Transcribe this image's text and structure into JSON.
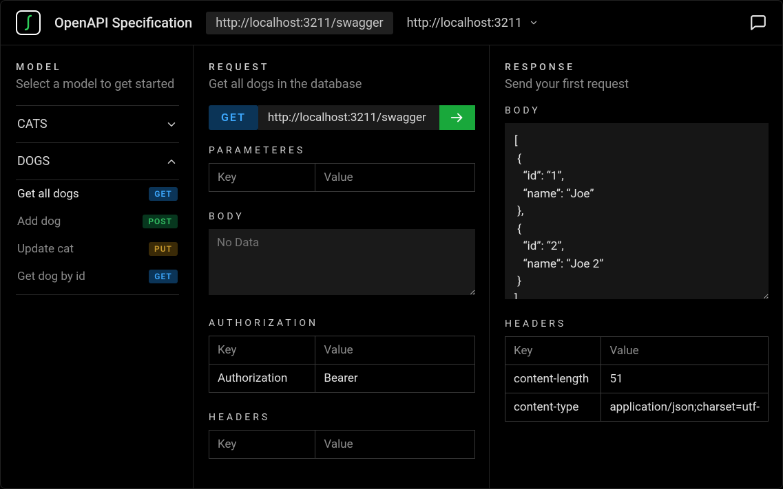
{
  "header": {
    "app_title": "OpenAPI Specification",
    "spec_url": "http://localhost:3211/swagger",
    "base_url": "http://localhost:3211"
  },
  "sidebar": {
    "title": "MODEL",
    "subtitle": "Select a model to get started",
    "groups": [
      {
        "name": "CATS",
        "expanded": false,
        "endpoints": []
      },
      {
        "name": "DOGS",
        "expanded": true,
        "endpoints": [
          {
            "label": "Get all dogs",
            "method": "GET",
            "active": true
          },
          {
            "label": "Add dog",
            "method": "POST",
            "active": false
          },
          {
            "label": "Update cat",
            "method": "PUT",
            "active": false
          },
          {
            "label": "Get dog by id",
            "method": "GET",
            "active": false
          }
        ]
      }
    ]
  },
  "request": {
    "title": "REQUEST",
    "subtitle": "Get all dogs in the database",
    "method": "GET",
    "url": "http://localhost:3211/swagger",
    "parameters": {
      "heading": "PARAMETERES",
      "key_header": "Key",
      "value_header": "Value",
      "rows": []
    },
    "body": {
      "heading": "BODY",
      "placeholder": "No Data",
      "value": ""
    },
    "authorization": {
      "heading": "AUTHORIZATION",
      "key_header": "Key",
      "value_header": "Value",
      "rows": [
        {
          "key": "Authorization",
          "value": "Bearer"
        }
      ]
    },
    "headers": {
      "heading": "HEADERS",
      "key_header": "Key",
      "value_header": "Value",
      "rows": []
    }
  },
  "response": {
    "title": "RESPONSE",
    "subtitle": "Send your first request",
    "body_heading": "BODY",
    "body_text": "[\n {\n   “id”: “1”,\n   “name”: “Joe”\n },\n {\n   “id”: “2”,\n   “name”: “Joe 2”\n }\n]",
    "headers_heading": "HEADERS",
    "headers_key_header": "Key",
    "headers_value_header": "Value",
    "headers_rows": [
      {
        "key": "content-length",
        "value": "51"
      },
      {
        "key": "content-type",
        "value": "application/json;charset=utf-"
      }
    ]
  }
}
